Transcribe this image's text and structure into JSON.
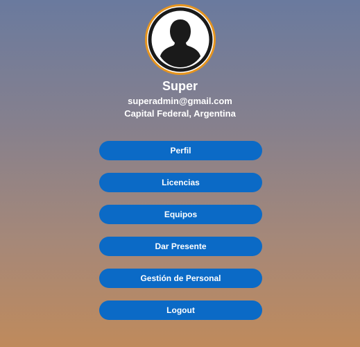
{
  "profile": {
    "name": "Super",
    "email": "superadmin@gmail.com",
    "location": "Capital Federal, Argentina",
    "avatar_icon": "user-silhouette-icon",
    "avatar_border_color": "#e6951f"
  },
  "menu": {
    "items": [
      {
        "label": "Perfil"
      },
      {
        "label": "Licencias"
      },
      {
        "label": "Equipos"
      },
      {
        "label": "Dar Presente"
      },
      {
        "label": "Gestión de Personal"
      },
      {
        "label": "Logout"
      }
    ],
    "button_color": "#0b6ac6"
  }
}
